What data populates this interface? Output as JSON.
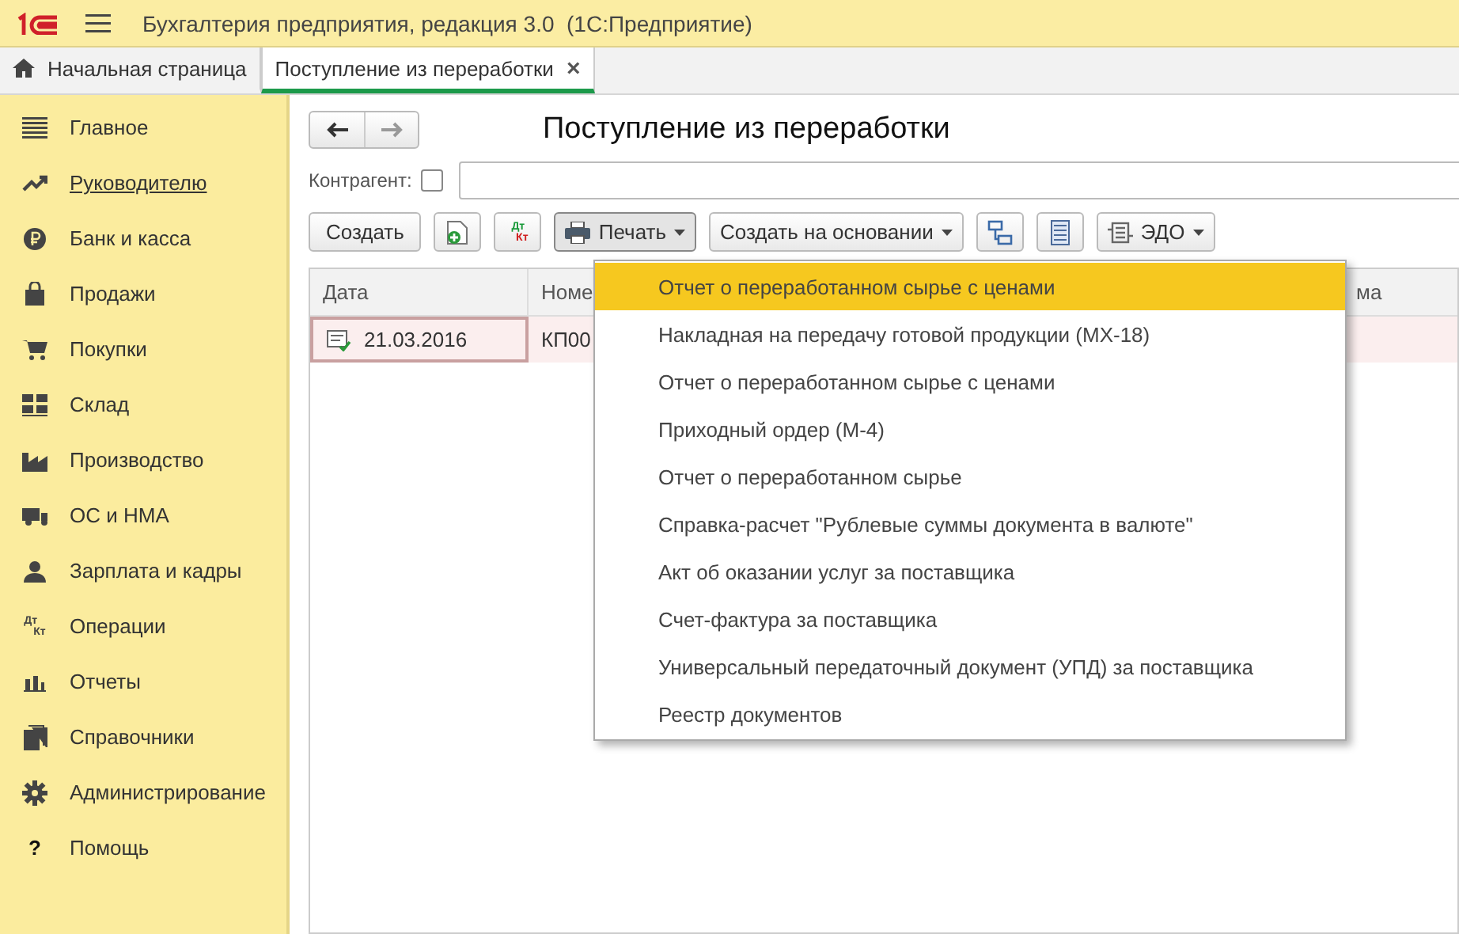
{
  "window": {
    "title": "Бухгалтерия предприятия, редакция 3.0  (1С:Предприятие)"
  },
  "tabs": [
    {
      "label": "Начальная страница",
      "kind": "home",
      "selected": false
    },
    {
      "label": "Поступление из переработки",
      "kind": "doc",
      "selected": true,
      "close": "×"
    }
  ],
  "sidebar": {
    "items": [
      {
        "label": "Главное",
        "selected": false
      },
      {
        "label": "Руководителю",
        "selected": true
      },
      {
        "label": "Банк и касса",
        "selected": false
      },
      {
        "label": "Продажи",
        "selected": false
      },
      {
        "label": "Покупки",
        "selected": false
      },
      {
        "label": "Склад",
        "selected": false
      },
      {
        "label": "Производство",
        "selected": false
      },
      {
        "label": "ОС и НМА",
        "selected": false
      },
      {
        "label": "Зарплата и кадры",
        "selected": false
      },
      {
        "label": "Операции",
        "icon_text": [
          "Дт",
          "Кт"
        ],
        "selected": false
      },
      {
        "label": "Отчеты",
        "selected": false
      },
      {
        "label": "Справочники",
        "selected": false
      },
      {
        "label": "Администрирование",
        "selected": false
      },
      {
        "label": "Помощь",
        "icon_text": [
          "?"
        ],
        "selected": false
      }
    ]
  },
  "form": {
    "title": "Поступление из переработки",
    "filter": {
      "label": "Контрагент:",
      "checked": false
    },
    "toolbar": [
      {
        "kind": "text",
        "label": "Создать"
      },
      {
        "kind": "icon"
      },
      {
        "kind": "dtkt",
        "icon_text": [
          "Дт",
          "Кт"
        ]
      },
      {
        "kind": "menu",
        "label": "Печать",
        "pressed": true
      },
      {
        "kind": "menu",
        "label": "Создать на основании",
        "pressed": false
      },
      {
        "kind": "icon"
      },
      {
        "kind": "icon"
      },
      {
        "kind": "menu",
        "label": "ЭДО",
        "pressed": false
      }
    ],
    "table": {
      "columns": [
        "Дата",
        "Номе",
        "ма"
      ],
      "rows": [
        {
          "cells": [
            "21.03.2016",
            "КП00"
          ],
          "selected": true
        }
      ]
    }
  },
  "print_menu": {
    "items": [
      {
        "label": "Отчет о переработанном сырье с ценами",
        "selected": true
      },
      {
        "label": "Накладная на передачу готовой продукции (МХ-18)",
        "selected": false
      },
      {
        "label": "Отчет о переработанном сырье с ценами",
        "selected": false
      },
      {
        "label": "Приходный ордер (М-4)",
        "selected": false
      },
      {
        "label": "Отчет о переработанном сырье",
        "selected": false
      },
      {
        "label": "Справка-расчет \"Рублевые суммы документа в валюте\"",
        "selected": false
      },
      {
        "label": "Акт об оказании услуг за поставщика",
        "selected": false
      },
      {
        "label": "Счет-фактура за поставщика",
        "selected": false
      },
      {
        "label": "Универсальный передаточный документ (УПД) за поставщика",
        "selected": false
      },
      {
        "label": "Реестр документов",
        "selected": false
      }
    ]
  }
}
